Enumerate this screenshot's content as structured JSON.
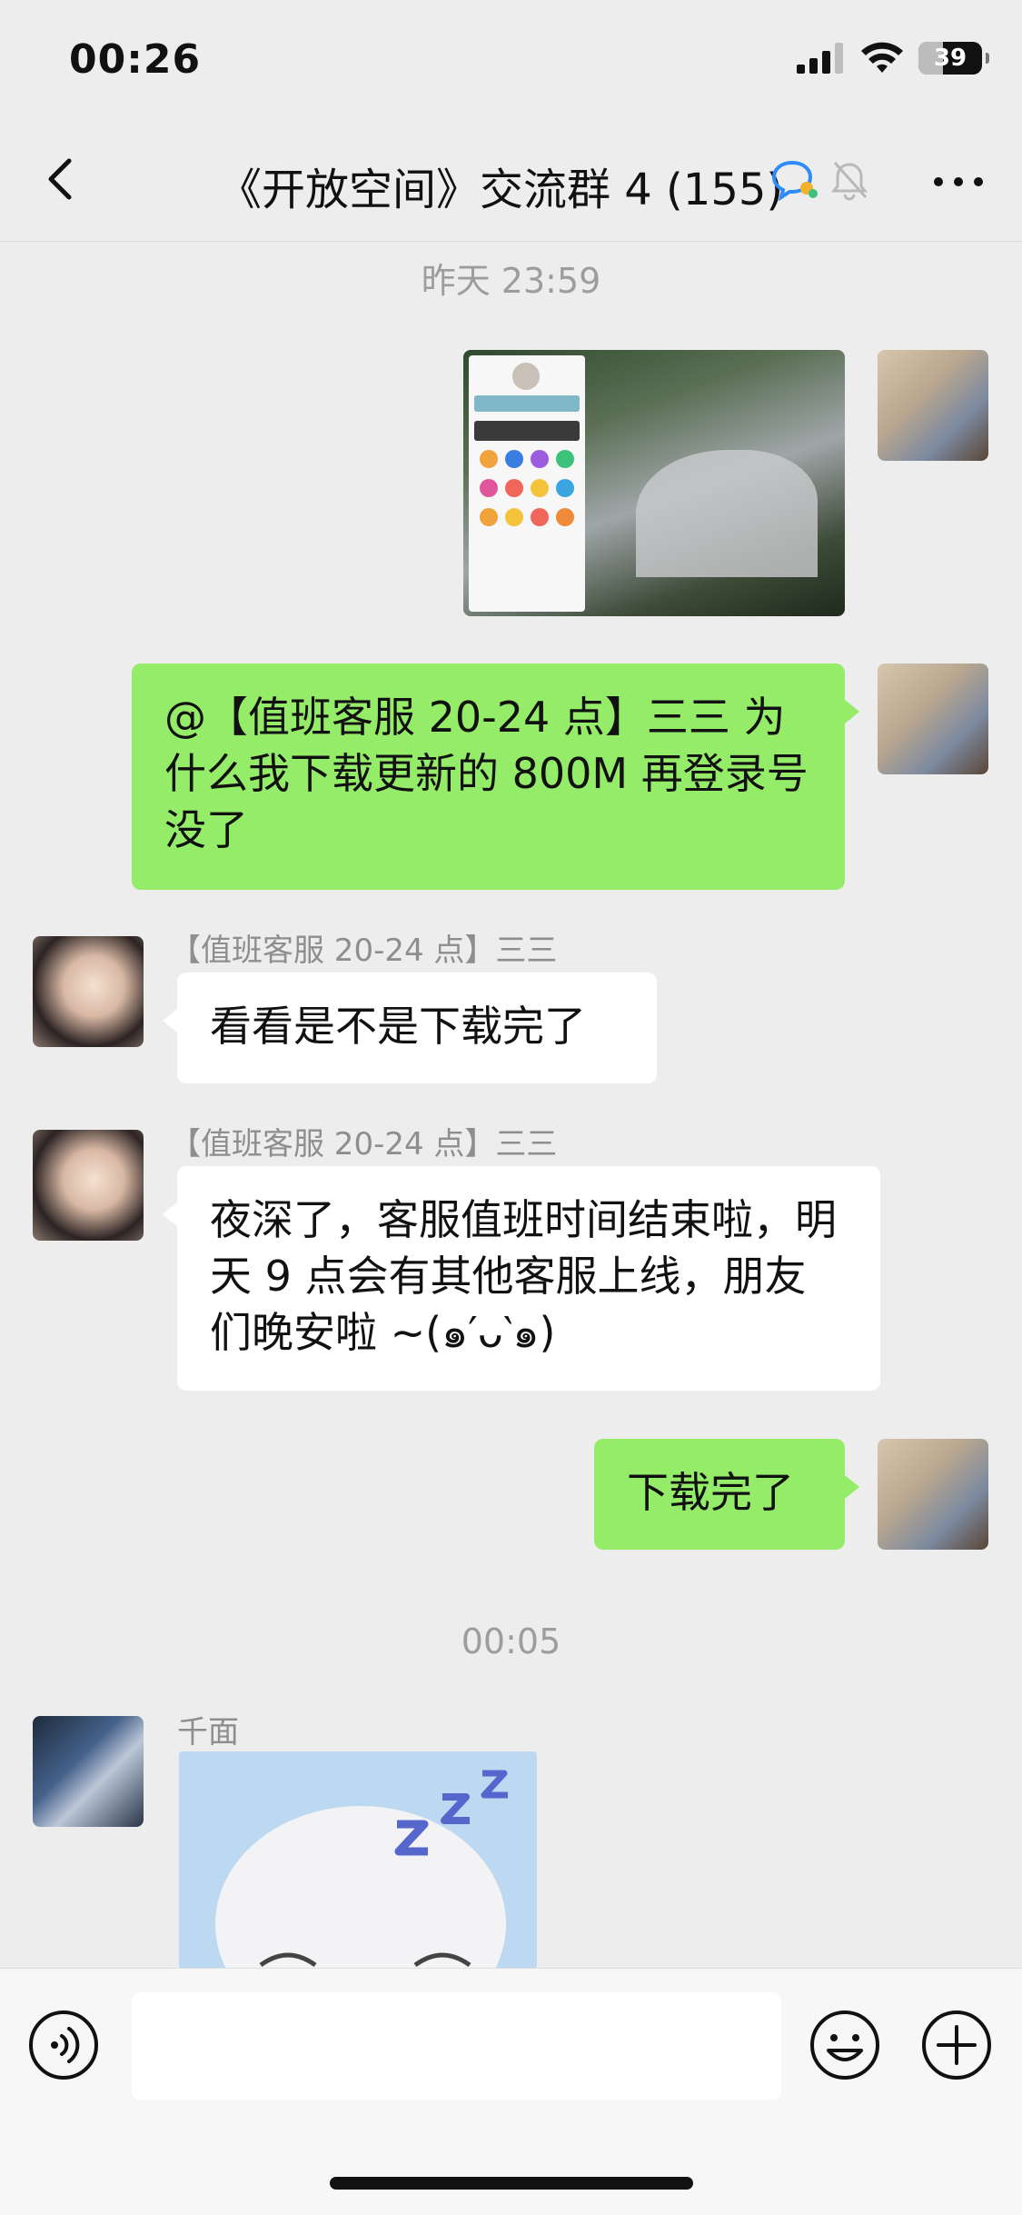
{
  "status_bar": {
    "time": "00:26",
    "battery": "39",
    "battery_level": 0.39
  },
  "nav": {
    "title": "《开放空间》交流群 4 (155)"
  },
  "timestamps": {
    "first": "昨天 23:59",
    "second": "00:05"
  },
  "messages": {
    "m2": "@【值班客服 20-24 点】三三 为什么我下载更新的 800M 再登录号没了",
    "m3_sender": "【值班客服 20-24 点】三三",
    "m3": "看看是不是下载完了",
    "m4_sender": "【值班客服 20-24 点】三三",
    "m4": "夜深了，客服值班时间结束啦，明天 9 点会有其他客服上线，朋友们晚安啦 ~(๑′ᴗ‵๑)",
    "m5": "下载完了",
    "m6_sender": "千面"
  },
  "colors": {
    "my_bubble": "#95ec69",
    "other_bubble": "#ffffff",
    "background": "#ededed"
  }
}
